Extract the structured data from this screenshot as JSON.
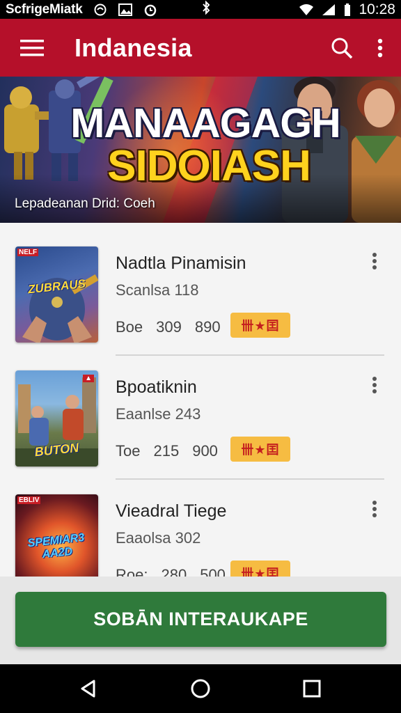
{
  "status_bar": {
    "carrier": "ScfrigeMiatk",
    "time": "10:28",
    "icons": [
      "notification-icon",
      "image-icon",
      "alarm-icon",
      "bluetooth-icon",
      "wifi-icon",
      "signal-icon",
      "battery-icon"
    ]
  },
  "app_bar": {
    "title": "Indanesia",
    "icons": [
      "menu-icon",
      "search-icon",
      "more-vert-icon"
    ],
    "color": "#b5102a"
  },
  "banner": {
    "headline_line1": "MANAAGAGH",
    "headline_line2": "SIDOIASH",
    "caption": "Lepadeanan Drid: Coeh"
  },
  "list": {
    "items": [
      {
        "name": "Nadtla Pinamisin",
        "subtitle": "Scanlsa 118",
        "stat_label": "Boe",
        "stat_a": "309",
        "stat_b": "890",
        "rating_badge": "卌★囯",
        "thumb_tag": "NELF",
        "thumb_logo": "ZUBRAUS"
      },
      {
        "name": "Bpoatiknin",
        "subtitle": "Eaanlse 243",
        "stat_label": "Toe",
        "stat_a": "215",
        "stat_b": "900",
        "rating_badge": "卌★囯",
        "thumb_tag": "",
        "thumb_logo": "BUTON"
      },
      {
        "name": "Vieadral Tiege",
        "subtitle": "Eaaolsa 302",
        "stat_label": "Roe:",
        "stat_a": "280",
        "stat_b": "500",
        "rating_badge": "卌★囯",
        "thumb_tag": "EBLIV",
        "thumb_logo": "SPEMIAR3 AA2D"
      }
    ]
  },
  "cta": {
    "label": "SOBĀN INTERAUKAPE",
    "color": "#2f7a3b"
  },
  "nav_bar": {
    "icons": [
      "back-icon",
      "home-icon",
      "recents-icon"
    ]
  }
}
